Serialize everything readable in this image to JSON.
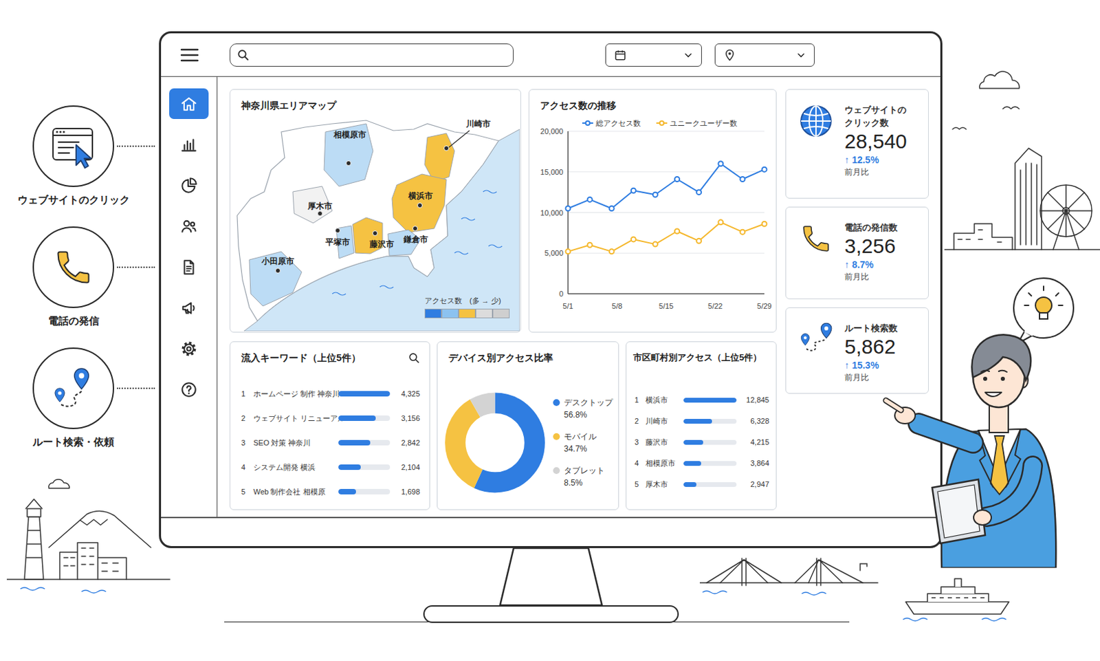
{
  "features": [
    {
      "label": "ウェブサイトのクリック"
    },
    {
      "label": "電話の発信"
    },
    {
      "label": "ルート検索・依頼"
    }
  ],
  "sidebar": {
    "items": [
      {
        "selected": true
      },
      {
        "selected": false
      },
      {
        "selected": false
      },
      {
        "selected": false
      },
      {
        "selected": false
      },
      {
        "selected": false
      },
      {
        "selected": false
      },
      {
        "selected": false
      }
    ]
  },
  "map": {
    "title": "神奈川県エリアマップ",
    "cities": [
      {
        "name": "相模原市",
        "color": "#bcdcf5"
      },
      {
        "name": "川崎市",
        "color": "#f5c242"
      },
      {
        "name": "厚木市",
        "color": "#f2f2f2"
      },
      {
        "name": "横浜市",
        "color": "#f5c242"
      },
      {
        "name": "平塚市",
        "color": "#bcdcf5"
      },
      {
        "name": "藤沢市",
        "color": "#f5c242"
      },
      {
        "name": "鎌倉市",
        "color": "#bcdcf5"
      },
      {
        "name": "小田原市",
        "color": "#bcdcf5"
      }
    ],
    "legend": {
      "label": "アクセス数　(多 → 少)",
      "colors": [
        "#2f7de1",
        "#8cc2f0",
        "#f5c242",
        "#dcdcdc",
        "#cfcfcf"
      ]
    }
  },
  "trend": {
    "title": "アクセス数の推移",
    "y_max": 20000,
    "y_ticks": [
      "20,000",
      "15,000",
      "10,000",
      "5,000",
      "0"
    ],
    "x_ticks": [
      "5/1",
      "5/8",
      "5/15",
      "5/22",
      "5/29"
    ],
    "series": [
      {
        "name": "総アクセス数",
        "color": "#2f7de1",
        "values": [
          10500,
          11600,
          10500,
          12700,
          12200,
          14100,
          12500,
          16000,
          14100,
          15300
        ]
      },
      {
        "name": "ユニークユーザー数",
        "color": "#f5b82e",
        "values": [
          5200,
          6000,
          5200,
          6700,
          6100,
          7700,
          6500,
          8800,
          7600,
          8600
        ]
      }
    ]
  },
  "kpis": [
    {
      "title_lines": [
        "ウェブサイトの",
        "クリック数"
      ],
      "value": "28,540",
      "change": "↑ 12.5%",
      "period": "前月比"
    },
    {
      "title_lines": [
        "電話の発信数"
      ],
      "value": "3,256",
      "change": "↑ 8.7%",
      "period": "前月比"
    },
    {
      "title_lines": [
        "ルート検索数"
      ],
      "value": "5,862",
      "change": "↑ 15.3%",
      "period": "前月比"
    }
  ],
  "keywords": {
    "title": "流入キーワード（上位5件）",
    "rows": [
      {
        "rank": "1",
        "keyword": "ホームページ 制作 神奈川",
        "count": "4,325",
        "level": 1.0
      },
      {
        "rank": "2",
        "keyword": "ウェブサイト リニューアル",
        "count": "3,156",
        "level": 0.73
      },
      {
        "rank": "3",
        "keyword": "SEO 対策 神奈川",
        "count": "2,842",
        "level": 0.62
      },
      {
        "rank": "4",
        "keyword": "システム開発 横浜",
        "count": "2,104",
        "level": 0.44
      },
      {
        "rank": "5",
        "keyword": "Web 制作会社 相模原",
        "count": "1,698",
        "level": 0.34
      }
    ]
  },
  "devices": {
    "title": "デバイス別アクセス比率",
    "items": [
      {
        "name": "デスクトップ",
        "percent": "56.8%",
        "level": 0.568,
        "color": "#2f7de1"
      },
      {
        "name": "モバイル",
        "percent": "34.7%",
        "level": 0.347,
        "color": "#f5c242"
      },
      {
        "name": "タブレット",
        "percent": "8.5%",
        "level": 0.085,
        "color": "#d3d3d3"
      }
    ]
  },
  "cities": {
    "title": "市区町村別アクセス（上位5件）",
    "rows": [
      {
        "rank": "1",
        "name": "横浜市",
        "count": "12,845",
        "level": 1.0
      },
      {
        "rank": "2",
        "name": "川崎市",
        "count": "6,328",
        "level": 0.54
      },
      {
        "rank": "3",
        "name": "藤沢市",
        "count": "4,215",
        "level": 0.37
      },
      {
        "rank": "4",
        "name": "相模原市",
        "count": "3,864",
        "level": 0.33
      },
      {
        "rank": "5",
        "name": "厚木市",
        "count": "2,947",
        "level": 0.24
      }
    ]
  }
}
